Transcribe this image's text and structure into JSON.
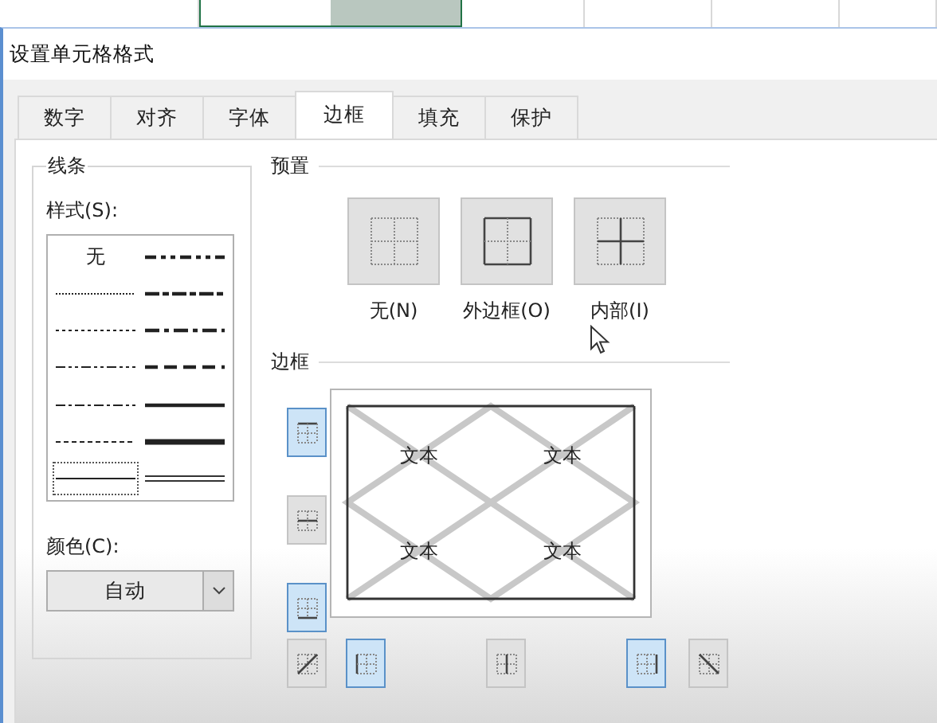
{
  "title": "设置单元格格式",
  "tabs": [
    {
      "label": "数字",
      "selected": false
    },
    {
      "label": "对齐",
      "selected": false
    },
    {
      "label": "字体",
      "selected": false
    },
    {
      "label": "边框",
      "selected": true
    },
    {
      "label": "填充",
      "selected": false
    },
    {
      "label": "保护",
      "selected": false
    }
  ],
  "line_group": {
    "title": "线条",
    "style_label": "样式(S):",
    "styles": [
      {
        "kind": "text",
        "label": "无",
        "selected": false
      },
      {
        "kind": "hair",
        "selected": false
      },
      {
        "kind": "dotted",
        "selected": false
      },
      {
        "kind": "dashdotdot",
        "selected": false
      },
      {
        "kind": "dashdot",
        "selected": false
      },
      {
        "kind": "dashed",
        "selected": false
      },
      {
        "kind": "thin",
        "selected": true
      },
      {
        "kind": "mediumdashdotdot",
        "selected": false
      },
      {
        "kind": "slantdashdot",
        "selected": false
      },
      {
        "kind": "mediumdashdot",
        "selected": false
      },
      {
        "kind": "mediumdashed",
        "selected": false
      },
      {
        "kind": "medium",
        "selected": false
      },
      {
        "kind": "thick",
        "selected": false
      },
      {
        "kind": "double",
        "selected": false
      }
    ],
    "color_label": "颜色(C):",
    "color_value": "自动"
  },
  "presets": {
    "title": "预置",
    "buttons": [
      {
        "kind": "none",
        "label": "无(N)"
      },
      {
        "kind": "outline",
        "label": "外边框(O)"
      },
      {
        "kind": "inside",
        "label": "内部(I)"
      }
    ]
  },
  "border": {
    "title": "边框",
    "side_buttons": [
      {
        "kind": "top",
        "selected": true
      },
      {
        "kind": "inside-horizontal",
        "selected": false
      },
      {
        "kind": "bottom",
        "selected": true
      }
    ],
    "bottom_buttons": [
      {
        "kind": "diagonal-up",
        "selected": false
      },
      {
        "kind": "left",
        "selected": true
      },
      {
        "kind": "inside-vertical",
        "selected": false
      },
      {
        "kind": "right",
        "selected": true
      },
      {
        "kind": "diagonal-down",
        "selected": false
      }
    ],
    "preview_texts": [
      "文本",
      "文本",
      "文本",
      "文本"
    ]
  }
}
